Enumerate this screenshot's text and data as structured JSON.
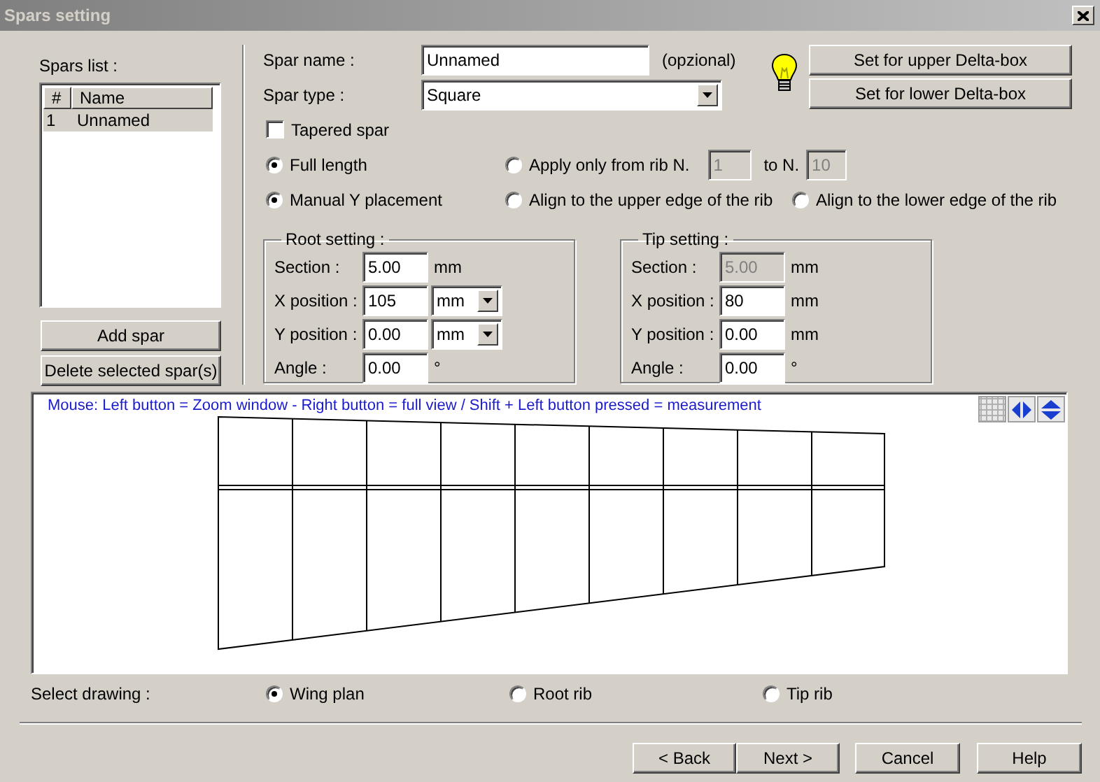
{
  "window": {
    "title": "Spars setting"
  },
  "spars_list": {
    "label": "Spars list :",
    "columns": [
      "#",
      "Name"
    ],
    "rows": [
      {
        "number": "1",
        "name": "Unnamed",
        "selected": true
      }
    ]
  },
  "list_buttons": [
    "Add spar",
    "Delete selected spar(s)"
  ],
  "spar_name": {
    "label": "Spar name :",
    "value": "Unnamed",
    "note": "(opzional)"
  },
  "spar_type": {
    "label": "Spar type :",
    "value": "Square"
  },
  "delta_box_buttons": [
    "Set for upper Delta-box",
    "Set for lower Delta-box"
  ],
  "tapered_spar": {
    "label": "Tapered spar",
    "checked": false
  },
  "range_options": [
    {
      "label": "Full length",
      "selected": true
    },
    {
      "label": "Apply only from rib N.",
      "selected": false
    }
  ],
  "rib_range": {
    "from": "1",
    "to_label": "to N.",
    "to": "10",
    "disabled": true
  },
  "placement_options": [
    {
      "label": "Manual Y placement",
      "selected": true
    },
    {
      "label": "Align to the upper edge of the rib",
      "selected": false
    },
    {
      "label": "Align to the lower edge of the rib",
      "selected": false
    }
  ],
  "settings": [
    {
      "title": "Root setting :",
      "rows": [
        {
          "label": "Section :",
          "value": "5.00",
          "unit": "mm",
          "kind": "text",
          "disabled": false
        },
        {
          "label": "X position :",
          "value": "105",
          "unit": "mm",
          "kind": "select",
          "disabled": false
        },
        {
          "label": "Y position :",
          "value": "0.00",
          "unit": "mm",
          "kind": "select",
          "disabled": false
        },
        {
          "label": "Angle :",
          "value": "0.00",
          "unit": "°",
          "kind": "text",
          "disabled": false
        }
      ]
    },
    {
      "title": "Tip setting  :",
      "rows": [
        {
          "label": "Section :",
          "value": "5.00",
          "unit": "mm",
          "kind": "text",
          "disabled": true
        },
        {
          "label": "X position :",
          "value": "80",
          "unit": "mm",
          "kind": "text",
          "disabled": false
        },
        {
          "label": "Y position :",
          "value": "0.00",
          "unit": "mm",
          "kind": "text",
          "disabled": false
        },
        {
          "label": "Angle :",
          "value": "0.00",
          "unit": "°",
          "kind": "text",
          "disabled": false
        }
      ]
    }
  ],
  "canvas": {
    "hint": "Mouse: Left button = Zoom window - Right button = full view / Shift + Left button pressed = measurement"
  },
  "select_drawing": {
    "label": "Select drawing :",
    "options": [
      {
        "label": "Wing plan",
        "selected": true
      },
      {
        "label": "Root rib",
        "selected": false
      },
      {
        "label": "Tip rib",
        "selected": false
      }
    ]
  },
  "footer_buttons": [
    "< Back",
    "Next >",
    "Cancel",
    "Help"
  ]
}
